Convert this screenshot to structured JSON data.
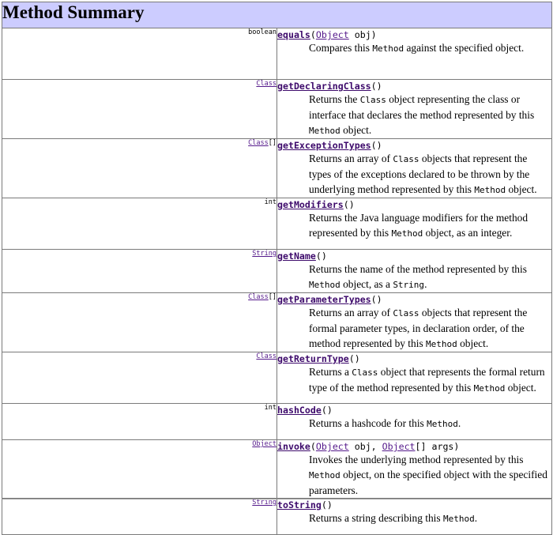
{
  "header": {
    "title": "Method Summary"
  },
  "methods": [
    {
      "type": "boolean",
      "name": "equals",
      "sig": [
        "(",
        "Object",
        " obj)"
      ],
      "desc": [
        "Compares this ",
        "Method",
        " against the specified object."
      ]
    },
    {
      "type": "Class",
      "name": "getDeclaringClass",
      "sig": [
        "()"
      ],
      "desc": [
        "Returns the ",
        "Class",
        " object representing the class or interface that declares the method represented by this ",
        "Method",
        " object."
      ]
    },
    {
      "type": "Class",
      "type_suffix": "[]",
      "name": "getExceptionTypes",
      "sig": [
        "()"
      ],
      "desc": [
        "Returns an array of ",
        "Class",
        " objects that represent the types of the exceptions declared to be thrown by the underlying method represented by this ",
        "Method",
        " object."
      ]
    },
    {
      "type": "int",
      "name": "getModifiers",
      "sig": [
        "()"
      ],
      "desc": [
        "Returns the Java language modifiers for the method represented by this ",
        "Method",
        " object, as an integer."
      ]
    },
    {
      "type": "String",
      "name": "getName",
      "sig": [
        "()"
      ],
      "desc": [
        "Returns the name of the method represented by this ",
        "Method",
        " object, as a ",
        "String",
        "."
      ]
    },
    {
      "type": "Class",
      "type_suffix": "[]",
      "name": "getParameterTypes",
      "sig": [
        "()"
      ],
      "desc": [
        "Returns an array of ",
        "Class",
        " objects that represent the formal parameter types, in declaration order, of the method represented by this ",
        "Method",
        " object."
      ]
    },
    {
      "type": "Class",
      "name": "getReturnType",
      "sig": [
        "()"
      ],
      "desc": [
        "Returns a ",
        "Class",
        " object that represents the formal return type of the method represented by this ",
        "Method",
        " object."
      ]
    },
    {
      "type": "int",
      "name": "hashCode",
      "sig": [
        "()"
      ],
      "desc": [
        "Returns a hashcode for this ",
        "Method",
        "."
      ]
    },
    {
      "type": "Object",
      "name": "invoke",
      "sig": [
        "(",
        "Object",
        " obj, ",
        "Object",
        "[] args)"
      ],
      "desc": [
        "Invokes the underlying method represented by this ",
        "Method",
        " object, on the specified object with the specified parameters."
      ]
    },
    {
      "type": "String",
      "name": "toString",
      "sig": [
        "()"
      ],
      "desc": [
        "Returns a string describing this ",
        "Method",
        "."
      ]
    }
  ]
}
